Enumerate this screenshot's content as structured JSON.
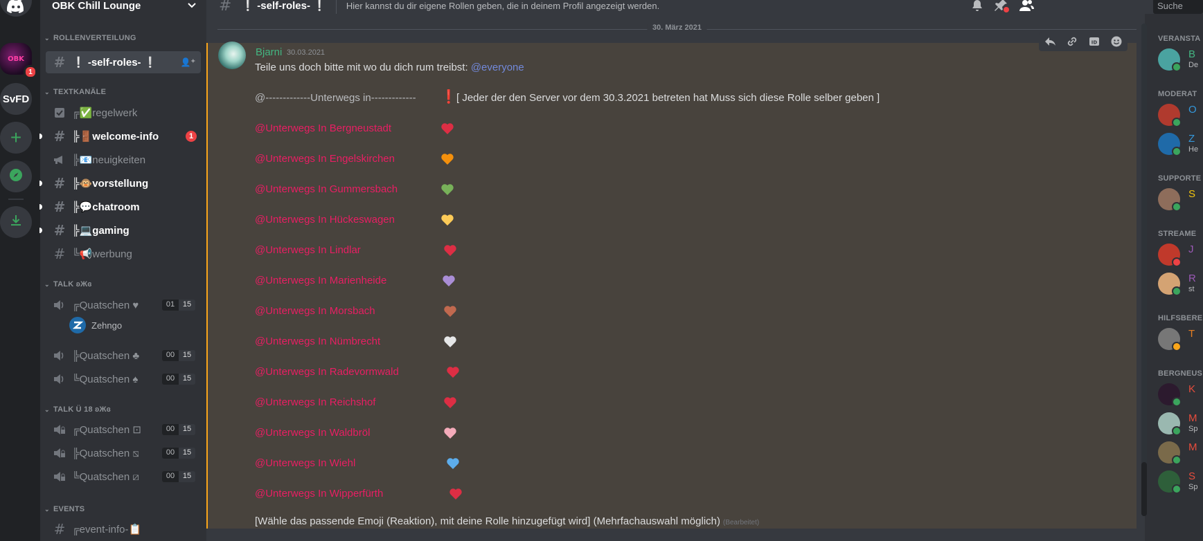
{
  "server_rail": {
    "servers": [
      {
        "name": "Discord Home",
        "icon": "discord-logo-icon"
      },
      {
        "name": "OBK Chill Lounge",
        "short": "OBK",
        "badge": "1"
      },
      {
        "name": "SvFD",
        "short": "SvFD"
      },
      {
        "name": "Add a Server",
        "icon": "plus-icon"
      },
      {
        "name": "Explore",
        "icon": "compass-icon"
      },
      {
        "name": "Download Apps",
        "icon": "download-icon"
      }
    ]
  },
  "guild": {
    "name": "OBK Chill Lounge"
  },
  "sidebar": {
    "categories": [
      {
        "label": "ROLLENVERTEILUNG"
      },
      {
        "label": "TEXTKANÄLE"
      },
      {
        "label": "TALK ʚЖɞ"
      },
      {
        "label": "TALK Ü 18 ʚЖɞ"
      },
      {
        "label": "EVENTS"
      }
    ],
    "channels": [
      {
        "name": "❕ -self-roles- ❕",
        "type": "text",
        "selected": true
      },
      {
        "name": "╔✅regelwerk",
        "type": "rules"
      },
      {
        "name": "╠🚪welcome-info",
        "type": "text",
        "unread": true,
        "mentions": "1"
      },
      {
        "name": "╠📧neuigkeiten",
        "type": "announcement"
      },
      {
        "name": "╠🐵vorstellung",
        "type": "text",
        "unread": true
      },
      {
        "name": "╠💬chatroom",
        "type": "text",
        "unread": true
      },
      {
        "name": "╠💻gaming",
        "type": "text",
        "unread": true
      },
      {
        "name": "╚📢werbung",
        "type": "text"
      },
      {
        "name": "╔Quatschen ♥",
        "type": "voice",
        "users": "01",
        "limit": "15"
      },
      {
        "name": "╠Quatschen ♣",
        "type": "voice",
        "users": "00",
        "limit": "15"
      },
      {
        "name": "╚Quatschen ♠",
        "type": "voice",
        "users": "00",
        "limit": "15"
      },
      {
        "name": "╔Quatschen ⊡",
        "type": "voice-locked",
        "users": "00",
        "limit": "15"
      },
      {
        "name": "╠Quatschen ⧅",
        "type": "voice-locked",
        "users": "00",
        "limit": "15"
      },
      {
        "name": "╚Quatschen ⧄",
        "type": "voice-locked",
        "users": "00",
        "limit": "15"
      },
      {
        "name": "╔event-info-📋",
        "type": "text"
      }
    ],
    "voice_user": {
      "name": "Zehngo"
    }
  },
  "topbar": {
    "channel": "❕ -self-roles- ❕",
    "topic": "Hier kannst du dir eigene Rollen geben, die in deinem Profil angezeigt werden.",
    "icons": [
      "bell-icon",
      "pin-icon",
      "members-icon"
    ],
    "search_placeholder": "Suche"
  },
  "chat": {
    "date_divider": "30. März 2021",
    "hover_tools": [
      "reply-icon",
      "link-icon",
      "id-icon",
      "add-reaction-icon"
    ],
    "message": {
      "author": "Bjarni",
      "timestamp": "30.03.2021",
      "intro": "Teile uns doch bitte mit wo du dich rum treibst: ",
      "everyone": "@everyone",
      "header_role": "@-------------Unterwegs in-------------",
      "header_note": "[  Jeder der den Server vor dem 30.3.2021 betreten hat Muss sich diese Rolle selber geben ]",
      "roles": [
        {
          "role": "@Unterwegs In Bergneustadt",
          "emoji": "❤️",
          "color": "#dd2e44"
        },
        {
          "role": "@Unterwegs In Engelskirchen",
          "emoji": "🧡",
          "color": "#f4900c"
        },
        {
          "role": "@Unterwegs In Gummersbach",
          "emoji": "💚",
          "color": "#78b159"
        },
        {
          "role": "@Unterwegs In Hückeswagen",
          "emoji": "💛",
          "color": "#fdcb58"
        },
        {
          "role": "@Unterwegs In Lindlar",
          "emoji": "💖",
          "color": "#dd2e44"
        },
        {
          "role": "@Unterwegs In Marienheide",
          "emoji": "💜",
          "color": "#aa8ed6"
        },
        {
          "role": "@Unterwegs In Morsbach",
          "emoji": "🤎",
          "color": "#c1694f"
        },
        {
          "role": "@Unterwegs In Nümbrecht",
          "emoji": "🤍",
          "color": "#e6e7e8"
        },
        {
          "role": "@Unterwegs In Radevormwald",
          "emoji": "💘",
          "color": "#dd2e44"
        },
        {
          "role": "@Unterwegs In Reichshof",
          "emoji": "💓",
          "color": "#dd2e44"
        },
        {
          "role": "@Unterwegs In Waldbröl",
          "emoji": "💗",
          "color": "#f4abba"
        },
        {
          "role": "@Unterwegs In Wiehl",
          "emoji": "💙",
          "color": "#5dadec"
        },
        {
          "role": "@Unterwegs In Wipperfürth",
          "emoji": "💝",
          "color": "#dd2e44"
        }
      ],
      "footer": "[Wähle das passende Emoji (Reaktion), mit deine Rolle hinzugefügt wird] (Mehrfachauswahl möglich)",
      "edited": "(Bearbeitet)"
    }
  },
  "members": {
    "groups": [
      {
        "label": "VERANSTA",
        "members": [
          {
            "name": "B",
            "sub": "De",
            "color": "#43b581"
          }
        ]
      },
      {
        "label": "MODERAT",
        "members": [
          {
            "name": "O",
            "sub": "",
            "color": "#3498db"
          },
          {
            "name": "Z",
            "sub": "He",
            "color": "#3498db"
          }
        ]
      },
      {
        "label": "SUPPORTE",
        "members": [
          {
            "name": "S",
            "sub": "",
            "color": "#f1c40f"
          }
        ]
      },
      {
        "label": "STREAME",
        "members": [
          {
            "name": "J",
            "sub": "",
            "color": "#9b59b6"
          },
          {
            "name": "R",
            "sub": "st",
            "color": "#9b59b6"
          }
        ]
      },
      {
        "label": "HILFSBERE",
        "members": [
          {
            "name": "T",
            "sub": "",
            "color": "#e67e22"
          }
        ]
      },
      {
        "label": "BERGNEUS",
        "members": [
          {
            "name": "K",
            "sub": "",
            "color": "#e74c3c"
          },
          {
            "name": "M",
            "sub": "Sp",
            "color": "#e74c3c"
          },
          {
            "name": "M",
            "sub": "",
            "color": "#e74c3c"
          },
          {
            "name": "S",
            "sub": "Sp",
            "color": "#e74c3c"
          }
        ]
      }
    ]
  },
  "colors": {
    "accent": "#5865f2",
    "role_pink": "#e91e63",
    "online": "#3ba55d",
    "highlight_bar": "#faa61a"
  }
}
